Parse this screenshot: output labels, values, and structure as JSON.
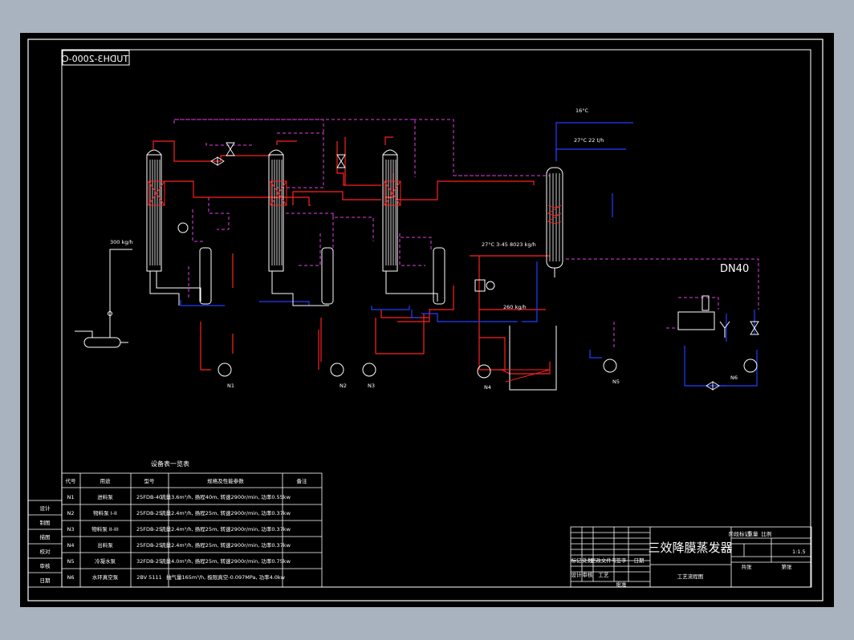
{
  "drawing": {
    "code": "TUDH3-2000-C",
    "title": "三效降膜蒸发器",
    "subtitle": "工艺流程图",
    "scale": "1:1.5",
    "dn_label": "DN40"
  },
  "stream_labels": {
    "water_in": "16°C",
    "water_out": "27°C 22 t/h",
    "steam_feed": "27°C 3-45 8023 kg/h",
    "cond_flow": "260 kg/h",
    "feed_flow": "300 kg/h"
  },
  "table": {
    "caption": "设备表一览表",
    "headers": [
      "代号",
      "用途",
      "型号",
      "规格及性能参数",
      "备注"
    ],
    "rows": [
      [
        "N1",
        "进料泵",
        "25FDB-40",
        "流量3.6m³/h, 扬程40m, 转速2900r/min, 功率0.55kw",
        ""
      ],
      [
        "N2",
        "物料泵 I-II",
        "25FDB-25",
        "流量2.4m³/h, 扬程25m, 转速2900r/min, 功率0.37kw",
        ""
      ],
      [
        "N3",
        "物料泵 II-III",
        "25FDB-25",
        "流量2.4m³/h, 扬程25m, 转速2900r/min, 功率0.37kw",
        ""
      ],
      [
        "N4",
        "出料泵",
        "25FDB-25",
        "流量2.4m³/h, 扬程25m, 转速2900r/min, 功率0.37kw",
        ""
      ],
      [
        "N5",
        "冷凝水泵",
        "32FDB-25",
        "流量4.0m³/h, 扬程25m, 转速2900r/min, 功率0.75kw",
        ""
      ],
      [
        "N6",
        "水环真空泵",
        "2BV 5111",
        "抽气量165m³/h, 极限真空-0.097MPa, 功率4.0kw",
        ""
      ]
    ]
  },
  "left_strip": {
    "items": [
      "设计",
      "制图",
      "描图",
      "校对",
      "审核",
      "日期"
    ]
  },
  "title_block": {
    "cells": [
      "标记",
      "处数",
      "更改文件号",
      "签字",
      "日期",
      "阶段标记",
      "重量",
      "比例",
      "共张",
      "第张",
      "设计",
      "审核",
      "工艺",
      "批准"
    ]
  },
  "pump_labels": [
    "N1",
    "N2",
    "N3",
    "N4",
    "N5",
    "N6"
  ]
}
